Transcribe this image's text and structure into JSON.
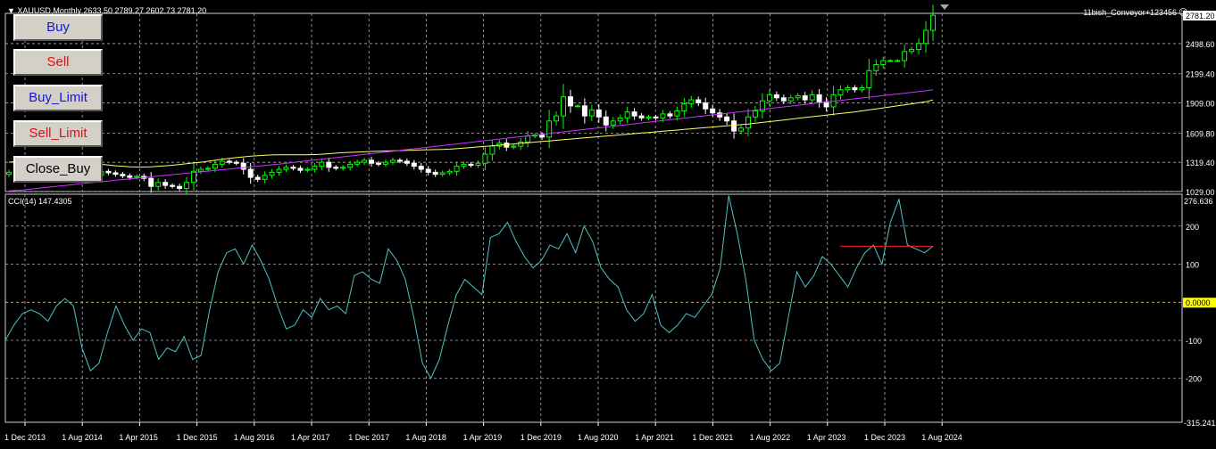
{
  "header": {
    "symbol": "XAUUSD,Monthly",
    "ohlc": "2633.50 2789.27 2602.73 2781.20",
    "expert": "11bish_Conveyor+123456"
  },
  "buttons": [
    {
      "label": "Buy",
      "color": "#1515d8"
    },
    {
      "label": "Sell",
      "color": "#e01010"
    },
    {
      "label": "Buy_Limit",
      "color": "#1515d8"
    },
    {
      "label": "Sell_Limit",
      "color": "#e01010"
    },
    {
      "label": "Close_Buy",
      "color": "#000000"
    }
  ],
  "price_axis": {
    "current": "2781.20",
    "ticks": [
      {
        "label": "2498.60",
        "value": 2498.6
      },
      {
        "label": "2199.40",
        "value": 2199.4
      },
      {
        "label": "1909.00",
        "value": 1909.0
      },
      {
        "label": "1609.80",
        "value": 1609.8
      },
      {
        "label": "1319.40",
        "value": 1319.4
      },
      {
        "label": "1029.00",
        "value": 1029.0
      }
    ]
  },
  "indicator": {
    "title": "CCI(14) 147.4305",
    "max_label": "276.636",
    "min_label": "-315.241",
    "ticks": [
      {
        "label": "200",
        "value": 200
      },
      {
        "label": "100",
        "value": 100
      },
      {
        "label": "-100",
        "value": -100
      },
      {
        "label": "-200",
        "value": -200
      }
    ],
    "zero_label": "0.0000"
  },
  "time_axis": [
    "1 Dec 2013",
    "1 Aug 2014",
    "1 Apr 2015",
    "1 Dec 2015",
    "1 Aug 2016",
    "1 Apr 2017",
    "1 Dec 2017",
    "1 Aug 2018",
    "1 Apr 2019",
    "1 Dec 2019",
    "1 Aug 2020",
    "1 Apr 2021",
    "1 Dec 2021",
    "1 Aug 2022",
    "1 Apr 2023",
    "1 Dec 2023",
    "1 Aug 2024"
  ],
  "colors": {
    "bull": "#00ff00",
    "bear": "#ffffff",
    "ma_fast": "#ffff66",
    "ma_slow": "#cc33ff",
    "cci": "#4fc3c3",
    "level": "#ff2020",
    "zero": "#ffff00",
    "grid": "#b0b0b0"
  },
  "chart_data": [
    {
      "type": "candlestick",
      "title": "XAUUSD,Monthly",
      "close": [
        1220,
        1310,
        1280,
        1300,
        1295,
        1320,
        1285,
        1250,
        1240,
        1235,
        1220,
        1210,
        1190,
        1230,
        1215,
        1200,
        1185,
        1170,
        1180,
        1160,
        1080,
        1120,
        1090,
        1080,
        1060,
        1120,
        1230,
        1250,
        1260,
        1300,
        1330,
        1320,
        1310,
        1250,
        1170,
        1150,
        1190,
        1220,
        1250,
        1270,
        1260,
        1240,
        1250,
        1280,
        1320,
        1270,
        1260,
        1270,
        1300,
        1320,
        1340,
        1310,
        1300,
        1320,
        1340,
        1330,
        1310,
        1280,
        1250,
        1220,
        1200,
        1215,
        1230,
        1280,
        1300,
        1290,
        1310,
        1400,
        1480,
        1510,
        1470,
        1480,
        1520,
        1580,
        1590,
        1570,
        1730,
        1780,
        1970,
        1880,
        1880,
        1780,
        1840,
        1770,
        1690,
        1730,
        1760,
        1820,
        1780,
        1760,
        1770,
        1760,
        1800,
        1780,
        1830,
        1900,
        1940,
        1910,
        1850,
        1810,
        1770,
        1730,
        1630,
        1660,
        1770,
        1830,
        1930,
        1990,
        1960,
        1930,
        1960,
        1980,
        1940,
        1990,
        1920,
        1870,
        1990,
        2040,
        2060,
        2040,
        2060,
        2230,
        2290,
        2330,
        2330,
        2330,
        2420,
        2440,
        2500,
        2630,
        2780
      ],
      "ma_fast": [
        1320,
        1329,
        1338,
        1342,
        1344,
        1343,
        1340,
        1335,
        1330,
        1325,
        1318,
        1310,
        1305,
        1300,
        1293,
        1285,
        1280,
        1275,
        1273,
        1272,
        1275,
        1280,
        1285,
        1290,
        1298,
        1306,
        1313,
        1320,
        1330,
        1340,
        1350,
        1358,
        1366,
        1373,
        1380,
        1385,
        1390,
        1393,
        1394,
        1394,
        1394,
        1394,
        1394,
        1396,
        1400,
        1405,
        1410,
        1415,
        1418,
        1421,
        1424,
        1427,
        1430,
        1432,
        1434,
        1436,
        1438,
        1440,
        1442,
        1444,
        1446,
        1448,
        1450,
        1455,
        1460,
        1466,
        1472,
        1478,
        1484,
        1490,
        1496,
        1502,
        1508,
        1514,
        1520,
        1526,
        1532,
        1538,
        1544,
        1550,
        1556,
        1562,
        1568,
        1574,
        1580,
        1586,
        1592,
        1598,
        1604,
        1610,
        1616,
        1622,
        1628,
        1634,
        1640,
        1646,
        1652,
        1658,
        1664,
        1670,
        1676,
        1682,
        1688,
        1694,
        1700,
        1708,
        1716,
        1724,
        1732,
        1740,
        1748,
        1756,
        1764,
        1772,
        1780,
        1788,
        1796,
        1804,
        1812,
        1820,
        1830,
        1840,
        1850,
        1860,
        1870,
        1880,
        1890,
        1900,
        1910,
        1920,
        1940
      ],
      "ma_slow_note": "",
      "ma_slow": [
        1035,
        1040,
        1045,
        1052,
        1060,
        1068,
        1075,
        1083,
        1090,
        1098,
        1106,
        1114,
        1120,
        1127,
        1134,
        1141,
        1148,
        1155,
        1162,
        1169,
        1176,
        1183,
        1190,
        1197,
        1204,
        1211,
        1218,
        1225,
        1232,
        1239,
        1246,
        1253,
        1260,
        1267,
        1274,
        1281,
        1288,
        1295,
        1302,
        1310,
        1318,
        1326,
        1334,
        1342,
        1350,
        1358,
        1366,
        1374,
        1382,
        1390,
        1398,
        1406,
        1414,
        1422,
        1430,
        1438,
        1446,
        1454,
        1462,
        1470,
        1478,
        1486,
        1494,
        1502,
        1510,
        1518,
        1526,
        1534,
        1542,
        1550,
        1558,
        1566,
        1574,
        1582,
        1590,
        1598,
        1606,
        1614,
        1622,
        1630,
        1638,
        1646,
        1654,
        1662,
        1670,
        1678,
        1686,
        1694,
        1702,
        1710,
        1718,
        1726,
        1734,
        1742,
        1750,
        1758,
        1766,
        1774,
        1782,
        1790,
        1798,
        1806,
        1814,
        1822,
        1830,
        1838,
        1846,
        1854,
        1862,
        1870,
        1878,
        1886,
        1894,
        1902,
        1910,
        1918,
        1926,
        1934,
        1942,
        1950,
        1958,
        1966,
        1974,
        1982,
        1990,
        1998,
        2006,
        2014,
        2022,
        2030,
        2040
      ],
      "ylim": [
        1029.0,
        2781.2
      ]
    },
    {
      "type": "line",
      "title": "CCI(14) 147.4305",
      "values": [
        -100,
        -60,
        -30,
        -20,
        -30,
        -50,
        -10,
        10,
        -10,
        -120,
        -180,
        -160,
        -80,
        -10,
        -60,
        -100,
        -70,
        -80,
        -150,
        -120,
        -130,
        -90,
        -150,
        -140,
        -20,
        80,
        130,
        140,
        100,
        150,
        110,
        60,
        -10,
        -70,
        -60,
        -20,
        -40,
        10,
        -20,
        -10,
        -30,
        70,
        80,
        60,
        50,
        140,
        110,
        60,
        -40,
        -160,
        -200,
        -150,
        -60,
        20,
        60,
        40,
        20,
        170,
        180,
        210,
        160,
        120,
        90,
        110,
        150,
        140,
        180,
        130,
        200,
        160,
        90,
        60,
        40,
        -20,
        -50,
        -30,
        20,
        -60,
        -80,
        -60,
        -30,
        -40,
        -10,
        20,
        90,
        280,
        180,
        60,
        -100,
        -150,
        -180,
        -160,
        -40,
        80,
        40,
        70,
        120,
        100,
        70,
        40,
        90,
        130,
        150,
        100,
        210,
        270,
        150,
        140,
        130,
        147
      ],
      "level": 147,
      "ylim": [
        -315.241,
        276.636
      ]
    }
  ]
}
